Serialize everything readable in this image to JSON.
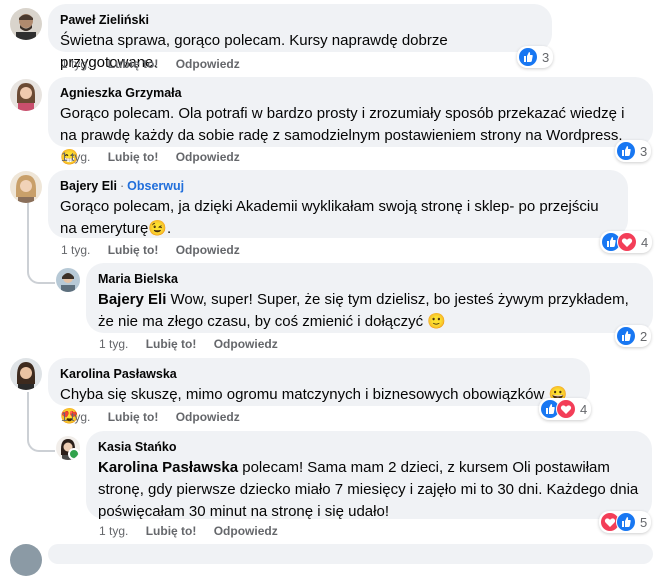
{
  "comments": [
    {
      "author": "Paweł Zieliński",
      "text": "Świetna sprawa, gorąco polecam. Kursy naprawdę dobrze przygotowane.",
      "time": "1 tyg.",
      "like": "Lubię to!",
      "reply": "Odpowiedz",
      "reactions": {
        "types": [
          "like"
        ],
        "count": "3"
      }
    },
    {
      "author": "Agnieszka Grzymała",
      "text": "Gorąco polecam. Ola potrafi w bardzo prosty i zrozumiały sposób przekazać wiedzę i na prawdę każdy da sobie radę z samodzielnym postawieniem strony na Wordpress. 😁",
      "time": "1 tyg.",
      "like": "Lubię to!",
      "reply": "Odpowiedz",
      "reactions": {
        "types": [
          "like"
        ],
        "count": "3"
      }
    },
    {
      "author": "Bajery Eli",
      "follow": "Obserwuj",
      "text": "Gorąco polecam, ja dzięki Akademii wyklikałam swoją stronę i sklep- po przejściu na emeryturę😉.",
      "time": "1 tyg.",
      "like": "Lubię to!",
      "reply": "Odpowiedz",
      "reactions": {
        "types": [
          "like",
          "love"
        ],
        "count": "4"
      }
    },
    {
      "author": "Maria Bielska",
      "mention": "Bajery Eli",
      "text": " Wow, super! Super, że się tym dzielisz, bo jesteś żywym przykładem, że nie ma złego czasu, by coś zmienić i dołączyć 🙂",
      "time": "1 tyg.",
      "like": "Lubię to!",
      "reply": "Odpowiedz",
      "reactions": {
        "types": [
          "like"
        ],
        "count": "2"
      }
    },
    {
      "author": "Karolina Pasławska",
      "text": "Chyba się skuszę, mimo ogromu matczynych i biznesowych obowiązków 😀😍",
      "time": "1 tyg.",
      "like": "Lubię to!",
      "reply": "Odpowiedz",
      "reactions": {
        "types": [
          "like",
          "love"
        ],
        "count": "4"
      }
    },
    {
      "author": "Kasia Stańko",
      "mention": "Karolina Pasławska",
      "text": " polecam! Sama mam 2 dzieci, z kursem Oli postawiłam stronę, gdy pierwsze dziecko miało 7 miesięcy i zajęło mi to 30 dni. Każdego dnia poświęcałam 30 minut na stronę i się udało!",
      "time": "1 tyg.",
      "like": "Lubię to!",
      "reply": "Odpowiedz",
      "reactions": {
        "types": [
          "love",
          "like"
        ],
        "count": "5"
      }
    }
  ],
  "colors": {
    "bubble": "#f0f2f5",
    "like": "#1877f2",
    "love": "#f33e58",
    "follow": "#216fdb",
    "meta": "#65676b"
  }
}
